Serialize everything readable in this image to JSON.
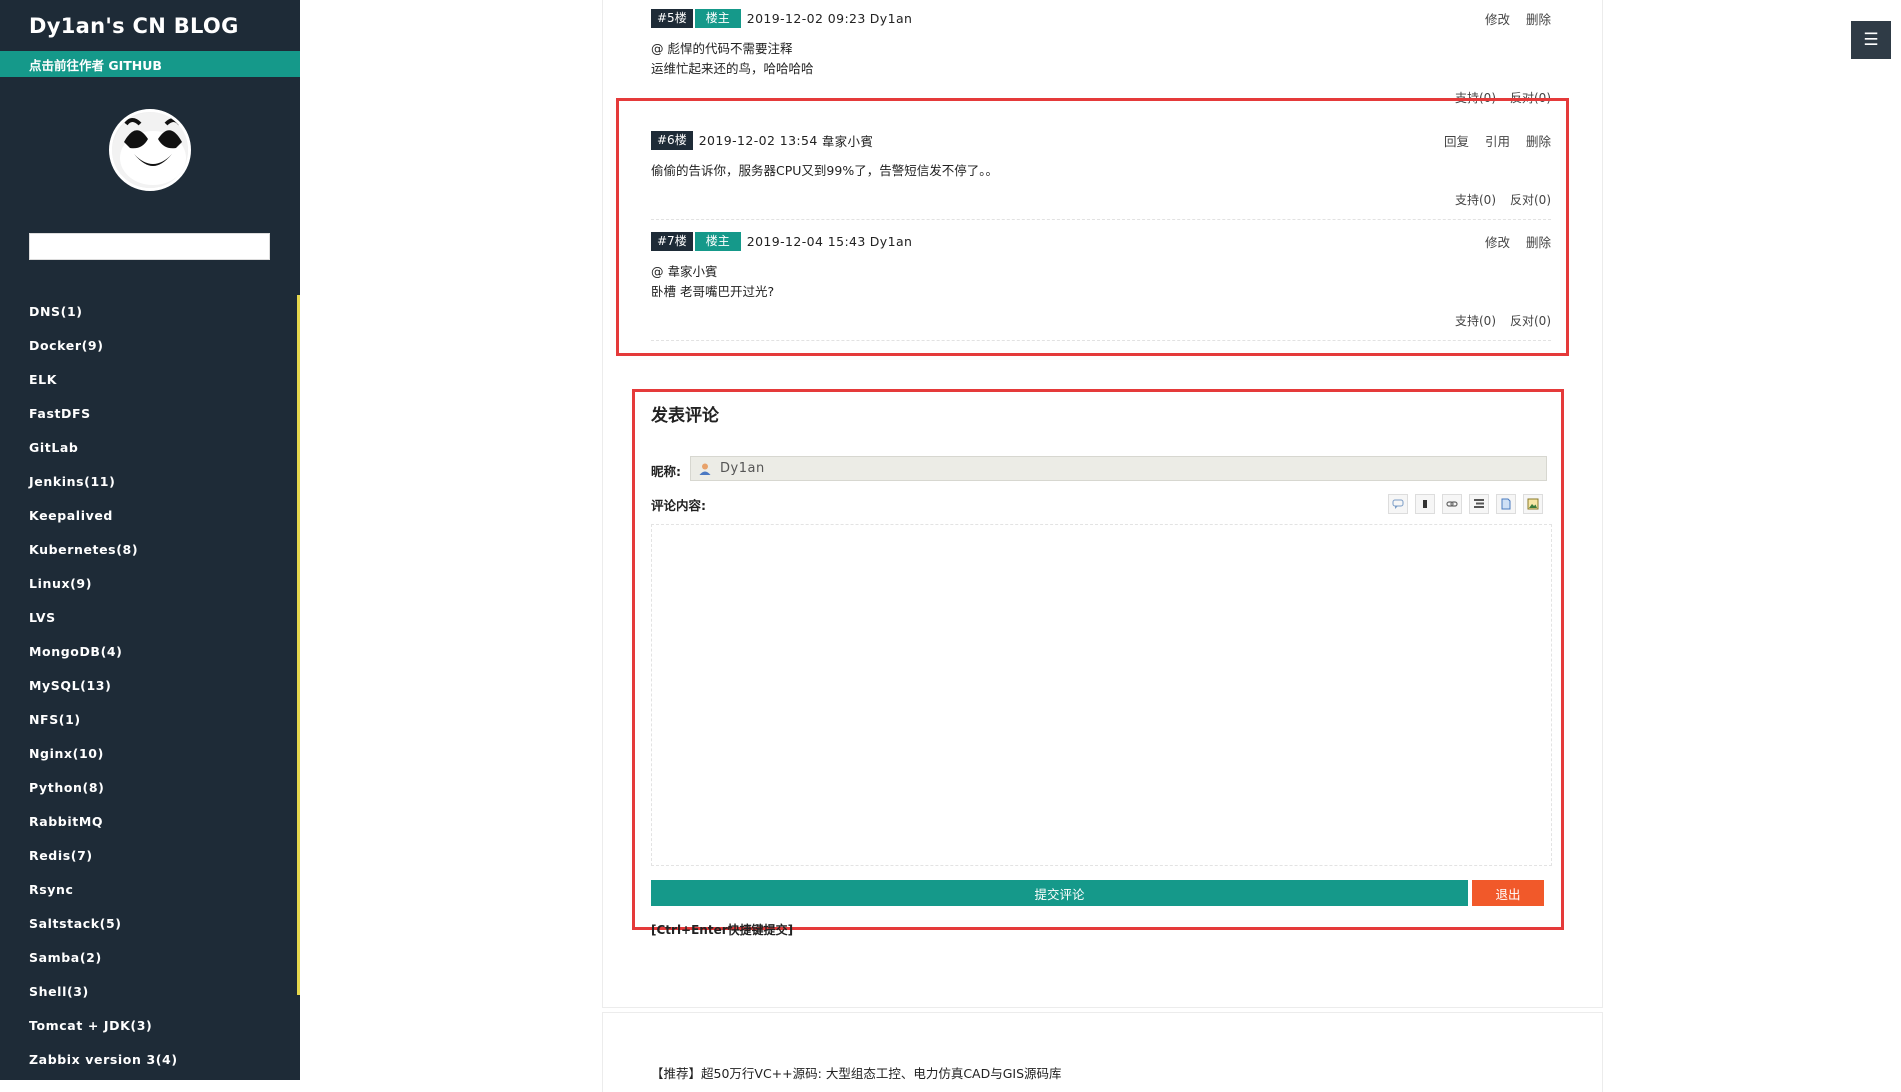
{
  "sidebar": {
    "brand": "Dy1an's CN BLOG",
    "github_link": "点击前往作者 GITHUB",
    "search_value": "",
    "categories": [
      "DNS(1)",
      "Docker(9)",
      "ELK",
      "FastDFS",
      "GitLab",
      "Jenkins(11)",
      "Keepalived",
      "Kubernetes(8)",
      "Linux(9)",
      "LVS",
      "MongoDB(4)",
      "MySQL(13)",
      "NFS(1)",
      "Nginx(10)",
      "Python(8)",
      "RabbitMQ",
      "Redis(7)",
      "Rsync",
      "Saltstack(5)",
      "Samba(2)",
      "Shell(3)",
      "Tomcat + JDK(3)",
      "Zabbix version 3(4)"
    ]
  },
  "menu_toggle": "☰",
  "comments": [
    {
      "floor": "#5楼",
      "host_badge": "楼主",
      "datetime": "2019-12-02 09:23",
      "author": "Dy1an",
      "actions": [
        "修改",
        "删除"
      ],
      "body_lines": [
        "@ 彪悍的代码不需要注释",
        "运维忙起来还的鸟，哈哈哈哈"
      ],
      "support": "支持(0)",
      "oppose": "反对(0)"
    },
    {
      "floor": "#6楼",
      "host_badge": "",
      "datetime": "2019-12-02 13:54",
      "author": "韋家小賓",
      "actions": [
        "回复",
        "引用",
        "删除"
      ],
      "body_lines": [
        "偷偷的告诉你，服务器CPU又到99%了，告警短信发不停了。。"
      ],
      "support": "支持(0)",
      "oppose": "反对(0)"
    },
    {
      "floor": "#7楼",
      "host_badge": "楼主",
      "datetime": "2019-12-04 15:43",
      "author": "Dy1an",
      "actions": [
        "修改",
        "删除"
      ],
      "body_lines": [
        "@ 韋家小賓",
        "卧槽 老哥嘴巴开过光?"
      ],
      "support": "支持(0)",
      "oppose": "反对(0)"
    }
  ],
  "form": {
    "title": "发表评论",
    "nick_label": "昵称:",
    "nick_value": "Dy1an",
    "content_label": "评论内容:",
    "toolbar_icons": [
      "reply-icon",
      "bold-icon",
      "link-icon",
      "code-icon",
      "quote-icon",
      "image-icon"
    ],
    "textarea_value": "",
    "submit_label": "提交评论",
    "logout_label": "退出",
    "hint": "[Ctrl+Enter快捷键提交]"
  },
  "recommend_text": "【推荐】超50万行VC++源码: 大型组态工控、电力仿真CAD与GIS源码库",
  "colors": {
    "sidebar_bg": "#1e2b37",
    "accent_teal": "#15998a",
    "logout_orange": "#f1592a",
    "highlight_red": "#e53a3a",
    "sidebar_yellow": "#e6d74d"
  }
}
